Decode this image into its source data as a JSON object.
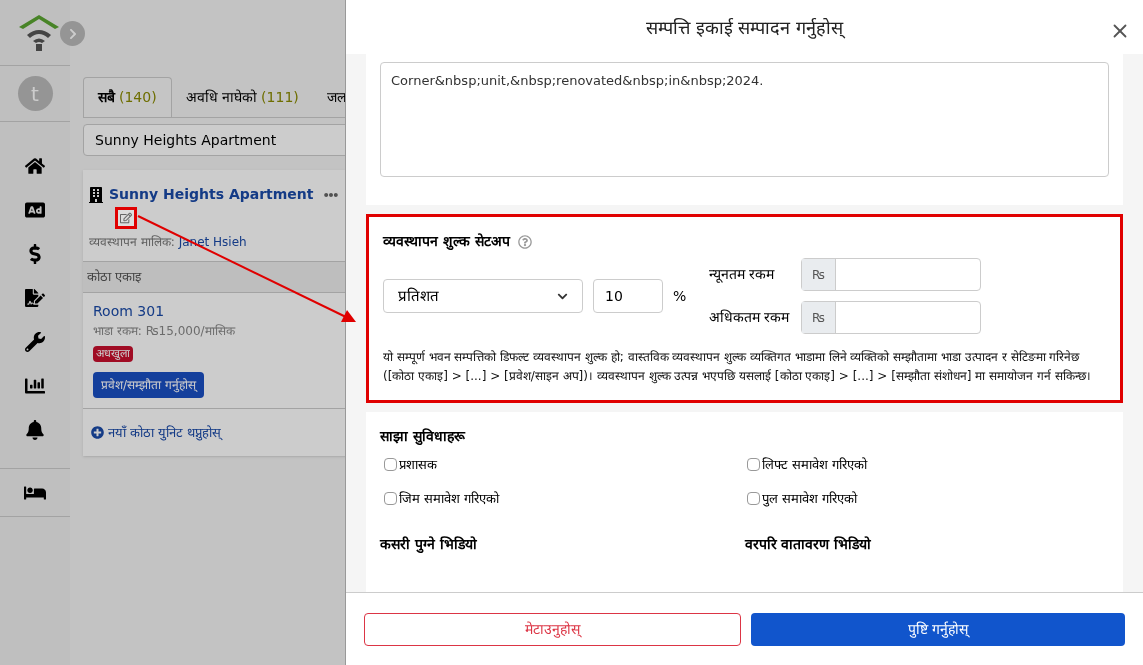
{
  "sidebar": {
    "avatar": "t"
  },
  "tabs": [
    {
      "label": "सबै",
      "count": "(140)",
      "selected": true
    },
    {
      "label": "अवधि नाघेको",
      "count": "(111)",
      "selected": false
    },
    {
      "label": "जल",
      "selected": false
    }
  ],
  "search": {
    "value": "Sunny Heights Apartment"
  },
  "property": {
    "name": "Sunny Heights Apartment",
    "manager_label": "व्यवस्थापन मालिक:",
    "manager": "Janet Hsieh",
    "section": "कोठा एकाइ",
    "units": [
      {
        "name": "Room 301",
        "rent": "भाडा रकम: ₨15,000/मासिक",
        "status": "अधखुला",
        "action": "प्रवेश/सम्झौता गर्नुहोस्"
      }
    ],
    "add": "नयाँ कोठा युनिट थप्नुहोस्"
  },
  "modal": {
    "title": "सम्पत्ति इकाई सम्पादन गर्नुहोस्",
    "description": "Corner&nbsp;unit,&nbsp;renovated&nbsp;in&nbsp;2024.",
    "fee": {
      "title": "व्यवस्थापन शुल्क सेटअप",
      "type": "प्रतिशत",
      "value": "10",
      "unit": "%",
      "min_label": "न्यूनतम रकम",
      "min_currency": "₨",
      "max_label": "अधिकतम रकम",
      "max_currency": "₨",
      "note": "यो सम्पूर्ण भवन सम्पत्तिको डिफल्ट व्यवस्थापन शुल्क हो; वास्तविक व्यवस्थापन शुल्क व्यक्तिगत भाडामा लिने व्यक्तिको सम्झौतामा भाडा उत्पादन र सेटिङमा गरिनेछ ([कोठा एकाइ] > [...] > [प्रवेश/साइन अप])। व्यवस्थापन शुल्क उत्पन्न भएपछि यसलाई [कोठा एकाइ] > [...] > [सम्झौता संशोधन] मा समायोजन गर्न सकिन्छ।"
    },
    "amenities": {
      "title": "साझा सुविधाहरू",
      "items": [
        {
          "label": "प्रशासक",
          "checked": false
        },
        {
          "label": "लिफ्ट समावेश गरिएको",
          "checked": false
        },
        {
          "label": "जिम समावेश गरिएको",
          "checked": false
        },
        {
          "label": "पुल समावेश गरिएको",
          "checked": false
        }
      ]
    },
    "videos": [
      "कसरी पुग्ने भिडियो",
      "वरपरि वातावरण भिडियो"
    ],
    "buttons": {
      "delete": "मेटाउनुहोस्",
      "confirm": "पुष्टि गर्नुहोस्"
    }
  }
}
